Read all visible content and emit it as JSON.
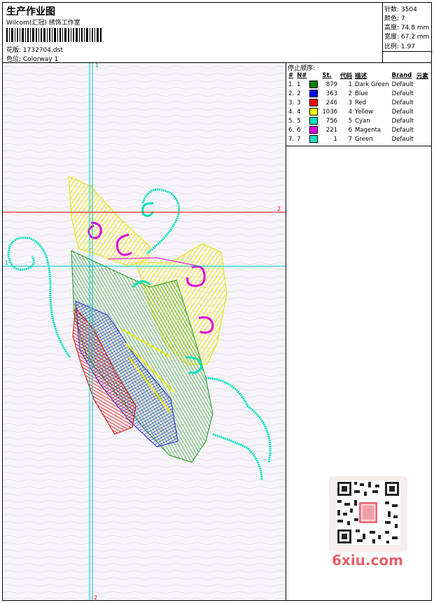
{
  "header": {
    "title": "生产作业图",
    "company": "Wilcom(汇冠) 绣饰工作室",
    "file_label": "花版: 1732704.dst",
    "colorway_label": "色位: Colorway 1"
  },
  "stats": {
    "stitches": "针数: 3504",
    "colors": "颜色: 7",
    "height": "高度: 74.8 mm",
    "width": "宽度: 67.2 mm",
    "scale": "比例: 1.97"
  },
  "legend": {
    "caption": "停止顺序:",
    "headers": [
      "#",
      "N#",
      "St.",
      "代码",
      "描述",
      "Brand",
      "元素"
    ],
    "rows": [
      {
        "num": "1.",
        "n": "1",
        "color": "#008000",
        "st": "879",
        "code": "1",
        "desc": "Dark Green",
        "brand": "Default"
      },
      {
        "num": "2.",
        "n": "2",
        "color": "#0000ff",
        "st": "363",
        "code": "2",
        "desc": "Blue",
        "brand": "Default"
      },
      {
        "num": "3.",
        "n": "3",
        "color": "#ff0000",
        "st": "246",
        "code": "3",
        "desc": "Red",
        "brand": "Default"
      },
      {
        "num": "4.",
        "n": "4",
        "color": "#ffff00",
        "st": "1036",
        "code": "4",
        "desc": "Yellow",
        "brand": "Default"
      },
      {
        "num": "5.",
        "n": "5",
        "color": "#00e0c0",
        "st": "756",
        "code": "5",
        "desc": "Cyan",
        "brand": "Default"
      },
      {
        "num": "6.",
        "n": "6",
        "color": "#e000e0",
        "st": "221",
        "code": "6",
        "desc": "Magenta",
        "brand": "Default"
      },
      {
        "num": "7.",
        "n": "7",
        "color": "#20e0c0",
        "st": "1",
        "code": "7",
        "desc": "Green",
        "brand": "Default"
      }
    ]
  },
  "guides": {
    "v_top": "1",
    "v_bottom": "2",
    "h_left": "1",
    "h_right": "2",
    "v_color": "#00e0e0",
    "h_color": "#ff0000"
  },
  "watermark": "6xiu.com"
}
